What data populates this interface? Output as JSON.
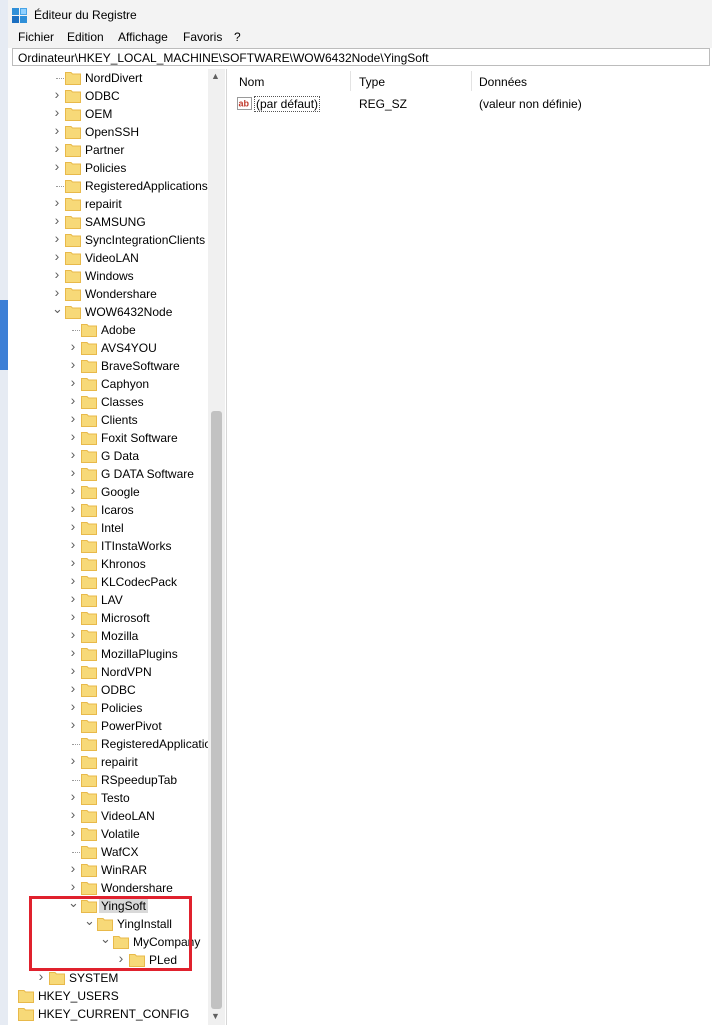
{
  "window": {
    "title": "Éditeur du Registre"
  },
  "menu": [
    "Fichier",
    "Edition",
    "Affichage",
    "Favoris",
    "?"
  ],
  "address": "Ordinateur\\HKEY_LOCAL_MACHINE\\SOFTWARE\\WOW6432Node\\YingSoft",
  "tree": [
    {
      "label": "NordDivert",
      "level": 1,
      "expander": "none"
    },
    {
      "label": "ODBC",
      "level": 1,
      "expander": "collapsed"
    },
    {
      "label": "OEM",
      "level": 1,
      "expander": "collapsed"
    },
    {
      "label": "OpenSSH",
      "level": 1,
      "expander": "collapsed"
    },
    {
      "label": "Partner",
      "level": 1,
      "expander": "collapsed"
    },
    {
      "label": "Policies",
      "level": 1,
      "expander": "collapsed"
    },
    {
      "label": "RegisteredApplications",
      "level": 1,
      "expander": "none"
    },
    {
      "label": "repairit",
      "level": 1,
      "expander": "collapsed"
    },
    {
      "label": "SAMSUNG",
      "level": 1,
      "expander": "collapsed"
    },
    {
      "label": "SyncIntegrationClients",
      "level": 1,
      "expander": "collapsed"
    },
    {
      "label": "VideoLAN",
      "level": 1,
      "expander": "collapsed"
    },
    {
      "label": "Windows",
      "level": 1,
      "expander": "collapsed"
    },
    {
      "label": "Wondershare",
      "level": 1,
      "expander": "collapsed"
    },
    {
      "label": "WOW6432Node",
      "level": 1,
      "expander": "expanded"
    },
    {
      "label": "Adobe",
      "level": 2,
      "expander": "none"
    },
    {
      "label": "AVS4YOU",
      "level": 2,
      "expander": "collapsed"
    },
    {
      "label": "BraveSoftware",
      "level": 2,
      "expander": "collapsed"
    },
    {
      "label": "Caphyon",
      "level": 2,
      "expander": "collapsed"
    },
    {
      "label": "Classes",
      "level": 2,
      "expander": "collapsed"
    },
    {
      "label": "Clients",
      "level": 2,
      "expander": "collapsed"
    },
    {
      "label": "Foxit Software",
      "level": 2,
      "expander": "collapsed"
    },
    {
      "label": "G Data",
      "level": 2,
      "expander": "collapsed"
    },
    {
      "label": "G DATA Software",
      "level": 2,
      "expander": "collapsed"
    },
    {
      "label": "Google",
      "level": 2,
      "expander": "collapsed"
    },
    {
      "label": "Icaros",
      "level": 2,
      "expander": "collapsed"
    },
    {
      "label": "Intel",
      "level": 2,
      "expander": "collapsed"
    },
    {
      "label": "ITInstaWorks",
      "level": 2,
      "expander": "collapsed"
    },
    {
      "label": "Khronos",
      "level": 2,
      "expander": "collapsed"
    },
    {
      "label": "KLCodecPack",
      "level": 2,
      "expander": "collapsed"
    },
    {
      "label": "LAV",
      "level": 2,
      "expander": "collapsed"
    },
    {
      "label": "Microsoft",
      "level": 2,
      "expander": "collapsed"
    },
    {
      "label": "Mozilla",
      "level": 2,
      "expander": "collapsed"
    },
    {
      "label": "MozillaPlugins",
      "level": 2,
      "expander": "collapsed"
    },
    {
      "label": "NordVPN",
      "level": 2,
      "expander": "collapsed"
    },
    {
      "label": "ODBC",
      "level": 2,
      "expander": "collapsed"
    },
    {
      "label": "Policies",
      "level": 2,
      "expander": "collapsed"
    },
    {
      "label": "PowerPivot",
      "level": 2,
      "expander": "collapsed"
    },
    {
      "label": "RegisteredApplications",
      "level": 2,
      "expander": "none"
    },
    {
      "label": "repairit",
      "level": 2,
      "expander": "collapsed"
    },
    {
      "label": "RSpeedupTab",
      "level": 2,
      "expander": "none"
    },
    {
      "label": "Testo",
      "level": 2,
      "expander": "collapsed"
    },
    {
      "label": "VideoLAN",
      "level": 2,
      "expander": "collapsed"
    },
    {
      "label": "Volatile",
      "level": 2,
      "expander": "collapsed"
    },
    {
      "label": "WafCX",
      "level": 2,
      "expander": "none"
    },
    {
      "label": "WinRAR",
      "level": 2,
      "expander": "collapsed"
    },
    {
      "label": "Wondershare",
      "level": 2,
      "expander": "collapsed"
    },
    {
      "label": "YingSoft",
      "level": 2,
      "expander": "expanded",
      "selected": true
    },
    {
      "label": "YingInstall",
      "level": 3,
      "expander": "expanded"
    },
    {
      "label": "MyCompany",
      "level": 4,
      "expander": "expanded"
    },
    {
      "label": "PLed",
      "level": 5,
      "expander": "collapsed"
    },
    {
      "label": "SYSTEM",
      "level": 0,
      "expander": "collapsed"
    },
    {
      "label": "HKEY_USERS",
      "level": -1,
      "expander": "none"
    },
    {
      "label": "HKEY_CURRENT_CONFIG",
      "level": -1,
      "expander": "none"
    }
  ],
  "list": {
    "columns": [
      "Nom",
      "Type",
      "Données"
    ],
    "rows": [
      {
        "name": "(par défaut)",
        "type": "REG_SZ",
        "data": "(valeur non définie)"
      }
    ]
  },
  "colors": {
    "folder": "#f7d978",
    "folder_dark": "#e8b94a",
    "highlight": "#e0212d",
    "selection": "#d9d9d9"
  }
}
